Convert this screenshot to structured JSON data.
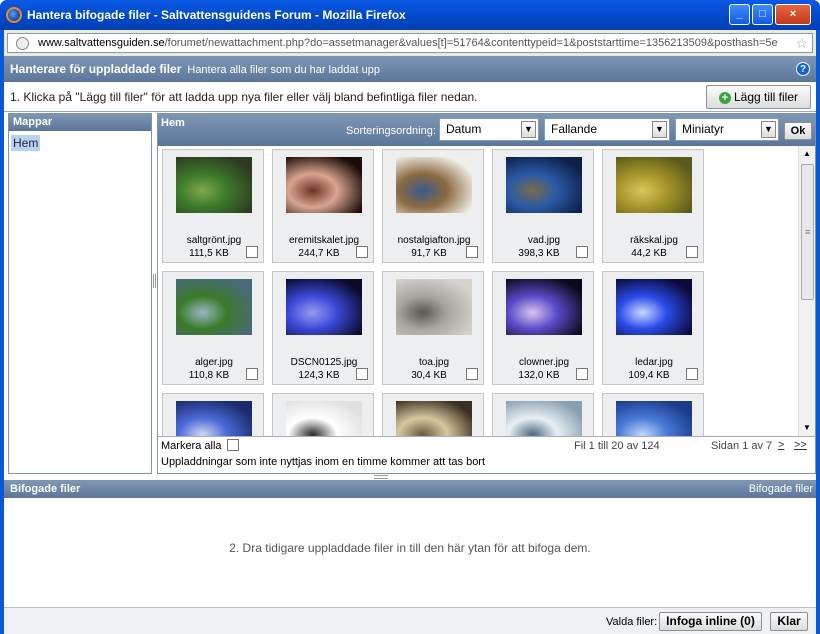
{
  "window": {
    "title": "Hantera bifogade filer - Saltvattensguidens Forum - Mozilla Firefox",
    "min": "_",
    "max": "□",
    "close": "×"
  },
  "url": {
    "domain": "www.saltvattensguiden.se",
    "path": "/forumet/newattachment.php?do=assetmanager&values[t]=51764&contenttypeid=1&poststarttime=1356213509&posthash=5e"
  },
  "header": {
    "title": "Hanterare för uppladdade filer",
    "subtitle": "Hantera alla filer som du har laddat upp",
    "help": "?"
  },
  "instruction": "1. Klicka på \"Lägg till filer\" för att ladda upp nya filer eller välj bland befintliga filer nedan.",
  "add_button": "Lägg till filer",
  "folders": {
    "title": "Mappar",
    "items": [
      "Hem"
    ]
  },
  "files": {
    "title": "Hem",
    "sort_label": "Sorteringsordning:",
    "sort_by": "Datum",
    "order": "Fallande",
    "view": "Miniatyr",
    "ok": "Ok",
    "items": [
      {
        "name": "saltgrönt.jpg",
        "size": "111,5 KB",
        "colors": [
          "#2d3a22",
          "#3c7a2a",
          "#7fa84a"
        ]
      },
      {
        "name": "eremitskalet.jpg",
        "size": "244,7 KB",
        "colors": [
          "#1a0c08",
          "#d8a590",
          "#6b3322"
        ]
      },
      {
        "name": "nostalgiafton.jpg",
        "size": "91,7 KB",
        "colors": [
          "#f2f0ea",
          "#8a6a40",
          "#3a5a8a"
        ]
      },
      {
        "name": "vad.jpg",
        "size": "398,3 KB",
        "colors": [
          "#0e1f4a",
          "#2a5aa6",
          "#7a6a4a"
        ]
      },
      {
        "name": "räkskal.jpg",
        "size": "44,2 KB",
        "colors": [
          "#5a5a1a",
          "#a8962a",
          "#d8c85a"
        ]
      },
      {
        "name": "alger.jpg",
        "size": "110,8 KB",
        "colors": [
          "#4a6a7a",
          "#3a7a2a",
          "#9ab6c4"
        ]
      },
      {
        "name": "DSCN0125.jpg",
        "size": "124,3 KB",
        "colors": [
          "#0a0a2a",
          "#3a4ad8",
          "#9a9af0"
        ]
      },
      {
        "name": "toa.jpg",
        "size": "30,4 KB",
        "colors": [
          "#d6d2cc",
          "#a8a49e",
          "#5a5650"
        ]
      },
      {
        "name": "clowner.jpg",
        "size": "132,0 KB",
        "colors": [
          "#0a0a1a",
          "#5a4ac8",
          "#d8c8f0"
        ]
      },
      {
        "name": "ledar.jpg",
        "size": "109,4 KB",
        "colors": [
          "#0a0a3a",
          "#2a4ae8",
          "#c8d8ff"
        ]
      },
      {
        "name": "",
        "size": "",
        "colors": [
          "#1a2a6a",
          "#4a6ad8",
          "#d0d8f0"
        ]
      },
      {
        "name": "",
        "size": "",
        "colors": [
          "#e0e0e0",
          "#ffffff",
          "#2a2a2a"
        ]
      },
      {
        "name": "",
        "size": "",
        "colors": [
          "#3a3020",
          "#d8c8a0",
          "#6a5a40"
        ]
      },
      {
        "name": "",
        "size": "",
        "colors": [
          "#8aa0b0",
          "#e8f0f4",
          "#4a6a80"
        ]
      },
      {
        "name": "",
        "size": "",
        "colors": [
          "#1a3a8a",
          "#4a7ad8",
          "#c0d8f8"
        ]
      }
    ],
    "select_all": "Markera alla",
    "note": "Uppladdningar som inte nyttjas inom en timme kommer att tas bort",
    "count": "Fil 1 till 20 av 124",
    "page": "Sidan 1 av 7",
    "next": ">",
    "last": ">>"
  },
  "attached": {
    "title": "Bifogade filer",
    "title_right": "Bifogade filer",
    "drop_text": "2. Dra tidigare uppladdade filer in till den här ytan för att bifoga dem.",
    "selected_label": "Valda filer:",
    "insert_button": "Infoga inline (0)",
    "close_button": "Klar"
  }
}
